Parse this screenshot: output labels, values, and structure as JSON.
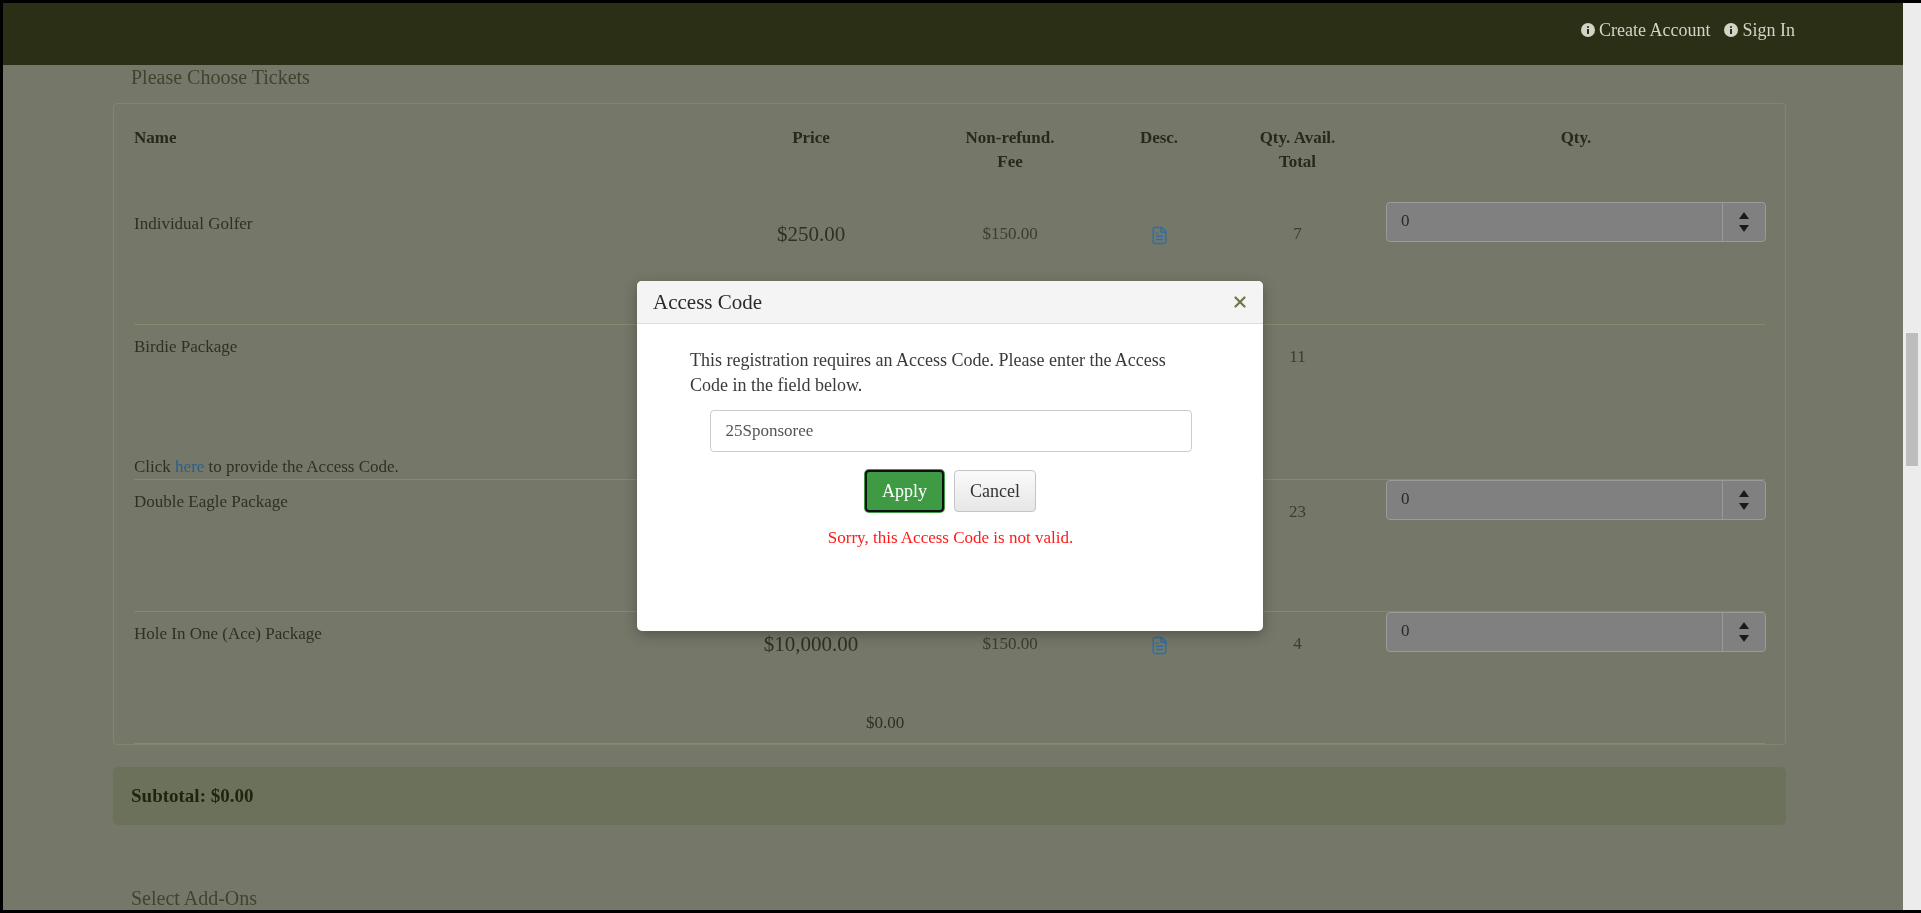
{
  "top_bar": {
    "links": [
      {
        "label": "Create Account"
      },
      {
        "label": "Sign In"
      }
    ]
  },
  "section_title": "Please Choose Tickets",
  "tickets": {
    "columns": [
      "Name",
      "Price",
      "Non-refund.\nFee",
      "Desc.",
      "Qty. Avail.\nTotal",
      "Qty."
    ],
    "rows": [
      {
        "name": "Individual Golfer",
        "price": "$250.00",
        "fee": "$150.00",
        "has_desc": true,
        "available": "7",
        "qty": "0"
      },
      {
        "name": "Birdie Package",
        "available": "11",
        "note_before": "Click",
        "note_link": "here",
        "note_after": "to provide the Access Code."
      },
      {
        "name": "Double Eagle Package",
        "available": "23",
        "qty": "0"
      },
      {
        "name": "Hole In One (Ace) Package",
        "price": "$10,000.00",
        "fee": "$150.00",
        "has_desc": true,
        "available": "4",
        "qty": "0",
        "line_total": "$0.00"
      }
    ]
  },
  "subtotal": "Subtotal: $0.00",
  "next_section_title": "Select Add-Ons",
  "modal": {
    "title": "Access Code",
    "message": "This registration requires an Access Code. Please enter the Access Code in the field below.",
    "code_value": "25Sponsoree",
    "buttons": [
      {
        "label": "Apply",
        "kind": "primary"
      },
      {
        "label": "Cancel",
        "kind": "default"
      }
    ],
    "error": "Sorry, this Access Code is not valid."
  }
}
